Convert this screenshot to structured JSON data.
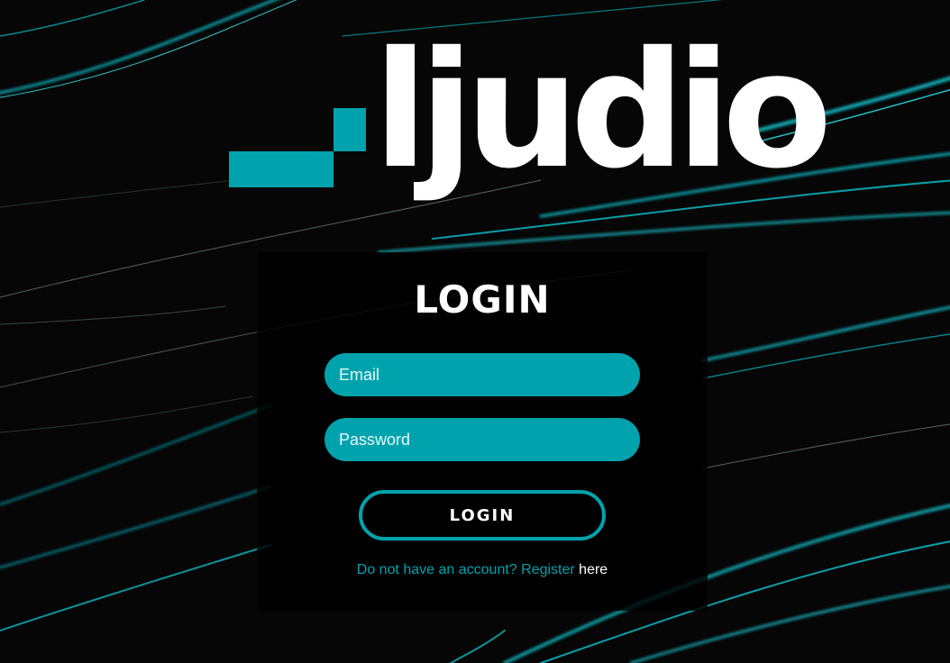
{
  "brand": {
    "name": "ljudio",
    "accent_color": "#00a3ad",
    "logo_icon": "corner-bracket-icon"
  },
  "login": {
    "title": "LOGIN",
    "email_placeholder": "Email",
    "password_placeholder": "Password",
    "submit_label": "LOGIN",
    "register_prompt": "Do not have an account? Register",
    "register_link": "here"
  },
  "colors": {
    "background": "#060606",
    "field_fill": "#00a3ad",
    "text": "#ffffff"
  }
}
